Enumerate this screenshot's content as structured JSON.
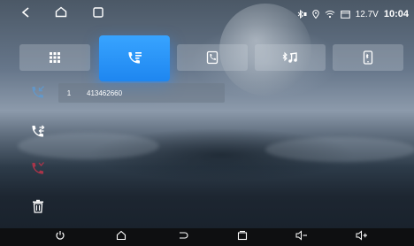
{
  "status_bar": {
    "voltage": "12.7V",
    "time": "10:04",
    "icons": [
      "bluetooth-icon",
      "location-icon",
      "wifi-icon",
      "calendar-icon"
    ]
  },
  "nav_buttons": [
    "back-icon",
    "home-icon",
    "recent-apps-icon"
  ],
  "tabs": [
    {
      "name": "tab-dialpad",
      "icon": "dialpad-icon",
      "active": false
    },
    {
      "name": "tab-call-log",
      "icon": "call-log-icon",
      "active": true
    },
    {
      "name": "tab-contacts",
      "icon": "contacts-icon",
      "active": false
    },
    {
      "name": "tab-music",
      "icon": "bluetooth-music-icon",
      "active": false
    },
    {
      "name": "tab-device",
      "icon": "phone-device-icon",
      "active": false
    }
  ],
  "side_actions": [
    "incoming-call-filter-icon",
    "outgoing-call-filter-icon",
    "missed-call-filter-icon",
    "delete-icon"
  ],
  "call_log": [
    {
      "index": "1",
      "number": "413462660"
    }
  ],
  "bottom_bar": [
    "power-icon",
    "home-icon",
    "back-icon",
    "recent-apps-icon",
    "volume-down-icon",
    "volume-up-icon"
  ],
  "colors": {
    "accent": "#2a95ff",
    "missed": "#d0344a"
  }
}
